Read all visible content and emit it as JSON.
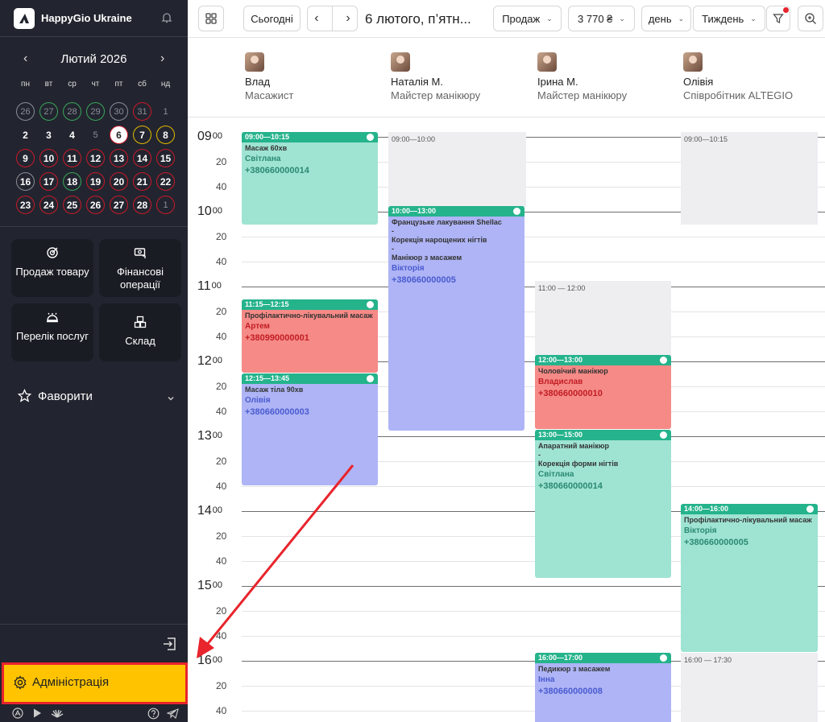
{
  "sidebar": {
    "app_title": "HappyGio Ukraine",
    "calendar": {
      "month": "Лютий 2026",
      "weekdays": [
        "пн",
        "вт",
        "ср",
        "чт",
        "пт",
        "сб",
        "нд"
      ],
      "weeks": [
        [
          {
            "d": "26",
            "s": "dim gray"
          },
          {
            "d": "27",
            "s": "dim green"
          },
          {
            "d": "28",
            "s": "dim green"
          },
          {
            "d": "29",
            "s": "dim green"
          },
          {
            "d": "30",
            "s": "dim gray"
          },
          {
            "d": "31",
            "s": "dim red"
          },
          {
            "d": "1",
            "s": "dim"
          }
        ],
        [
          {
            "d": "2",
            "s": ""
          },
          {
            "d": "3",
            "s": ""
          },
          {
            "d": "4",
            "s": ""
          },
          {
            "d": "5",
            "s": "dim"
          },
          {
            "d": "6",
            "s": "today"
          },
          {
            "d": "7",
            "s": "yellow"
          },
          {
            "d": "8",
            "s": "yellow"
          }
        ],
        [
          {
            "d": "9",
            "s": "red"
          },
          {
            "d": "10",
            "s": "red"
          },
          {
            "d": "11",
            "s": "red"
          },
          {
            "d": "12",
            "s": "red"
          },
          {
            "d": "13",
            "s": "red"
          },
          {
            "d": "14",
            "s": "red"
          },
          {
            "d": "15",
            "s": "red"
          }
        ],
        [
          {
            "d": "16",
            "s": "gray"
          },
          {
            "d": "17",
            "s": "red"
          },
          {
            "d": "18",
            "s": "green"
          },
          {
            "d": "19",
            "s": "red"
          },
          {
            "d": "20",
            "s": "red"
          },
          {
            "d": "21",
            "s": "red"
          },
          {
            "d": "22",
            "s": "red"
          }
        ],
        [
          {
            "d": "23",
            "s": "red"
          },
          {
            "d": "24",
            "s": "red"
          },
          {
            "d": "25",
            "s": "red"
          },
          {
            "d": "26",
            "s": "red"
          },
          {
            "d": "27",
            "s": "red"
          },
          {
            "d": "28",
            "s": "red"
          },
          {
            "d": "1",
            "s": "dim red"
          }
        ]
      ]
    },
    "tiles": {
      "sale": "Продаж товару",
      "finance": "Фінансові операції",
      "services": "Перелік послуг",
      "stock": "Склад"
    },
    "favorites": "Фаворити",
    "admin": "Адміністрація"
  },
  "toolbar": {
    "today": "Сьогодні",
    "date": "6 лютого, п’ятн...",
    "sales": "Продаж",
    "amount": "3 770 ₴",
    "mode_day": "день",
    "mode_week": "Тиждень"
  },
  "staff": [
    {
      "name": "Влад",
      "role": "Масажист"
    },
    {
      "name": "Наталія М.",
      "role": "Майстер манікюру"
    },
    {
      "name": "Ірина М.",
      "role": "Майстер манікюру"
    },
    {
      "name": "Олівія",
      "role": "Співробітник ALTEGIO"
    }
  ],
  "time": {
    "hours": [
      "09",
      "10",
      "11",
      "12",
      "13",
      "14",
      "15",
      "16"
    ],
    "minute_marks": [
      "00",
      "20",
      "40"
    ]
  },
  "busy": [
    {
      "label": "09:00—10:00"
    },
    {
      "label": "11:00 — 12:00"
    },
    {
      "label": "09:00—10:15"
    },
    {
      "label": "16:00 — 17:30"
    }
  ],
  "appointments": [
    {
      "time": "09:00—10:15",
      "service": "Масаж 60хв",
      "client": "Світлана",
      "phone": "+380660000014"
    },
    {
      "time": "11:15—12:15",
      "service": "Профілактично-лікувальний масаж",
      "client": "Артем",
      "phone": "+380990000001"
    },
    {
      "time": "12:15—13:45",
      "service": "Масаж тіла 90хв",
      "client": "Олівія",
      "phone": "+380660000003"
    },
    {
      "time": "10:00—13:00",
      "service": "Французьке лакування Shellac\n-\nКорекція нарощених нігтів\n-\nМанікюр з масажем",
      "client": "Вікторія",
      "phone": "+380660000005"
    },
    {
      "time": "12:00—13:00",
      "service": "Чоловічий манікюр",
      "client": "Владислав",
      "phone": "+380660000010"
    },
    {
      "time": "13:00—15:00",
      "service": "Апаратний манікюр\n-\nКорекція форми нігтів",
      "client": "Світлана",
      "phone": "+380660000014"
    },
    {
      "time": "16:00—17:00",
      "service": "Педикюр з масажем",
      "client": "Інна",
      "phone": "+380660000008"
    },
    {
      "time": "14:00—16:00",
      "service": "Профілактично-лікувальний масаж",
      "client": "Вікторія",
      "phone": "+380660000005"
    }
  ],
  "colors": {
    "sidebar_bg": "#22252f",
    "admin_highlight": "#ffc300",
    "annotation_red": "#e8242c",
    "appt_teal": "#9fe3d3",
    "appt_purple": "#aeb4f5",
    "appt_red": "#f58a86",
    "appt_header": "#25b38c"
  }
}
